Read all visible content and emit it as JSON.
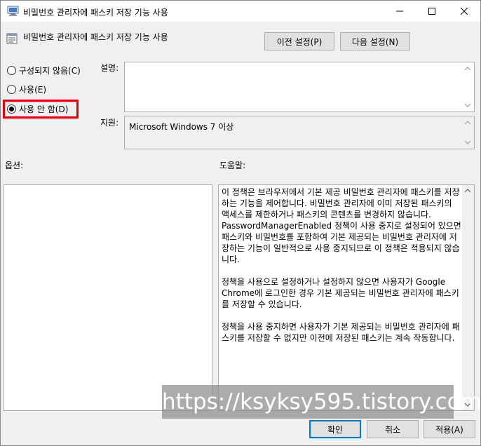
{
  "window": {
    "title": "비밀번호 관리자에 패스키 저장 기능 사용",
    "icon": "policy-editor-icon"
  },
  "policy": {
    "name": "비밀번호 관리자에 패스키 저장 기능 사용"
  },
  "nav": {
    "prev_label": "이전 설정(P)",
    "next_label": "다음 설정(N)"
  },
  "state": {
    "options": [
      {
        "label": "구성되지 않음(C)",
        "selected": false
      },
      {
        "label": "사용(E)",
        "selected": false
      },
      {
        "label": "사용 안 함(D)",
        "selected": true
      }
    ],
    "highlight_color": "#e00000"
  },
  "comment": {
    "label": "설명:",
    "value": ""
  },
  "supported": {
    "label": "지원:",
    "value": "Microsoft Windows 7 이상"
  },
  "options_panel": {
    "label": "옵션:"
  },
  "help": {
    "label": "도움말:",
    "paragraphs": [
      "이 정책은 브라우저에서 기본 제공 비밀번호 관리자에 패스키를 저장하는 기능을 제어합니다. 비밀번호 관리자에 이미 저장된 패스키의 액세스를 제한하거나 패스키의 콘텐츠를 변경하지 않습니다. PasswordManagerEnabled 정책이 사용 중지로 설정되어 있으면 패스키와 비밀번호를 포함하여 기본 제공되는 비밀번호 관리자에 저장하는 기능이 일반적으로 사용 중지되므로 이 정책은 적용되지 않습니다.",
      "정책을 사용으로 설정하거나 설정하지 않으면 사용자가 Google Chrome에 로그인한 경우 기본 제공되는 비밀번호 관리자에 패스키를 저장할 수 있습니다.",
      "정책을 사용 중지하면 사용자가 기본 제공되는 비밀번호 관리자에 패스키를 저장할 수 없지만 이전에 저장된 패스키는 계속 작동합니다."
    ]
  },
  "footer": {
    "ok_label": "확인",
    "cancel_label": "취소",
    "apply_label": "적용(A)"
  },
  "watermark": {
    "text": "https://ksyksy595.tistory.com"
  },
  "colors": {
    "accent": "#0078d7",
    "dialog_bg": "#f0f0f0"
  }
}
